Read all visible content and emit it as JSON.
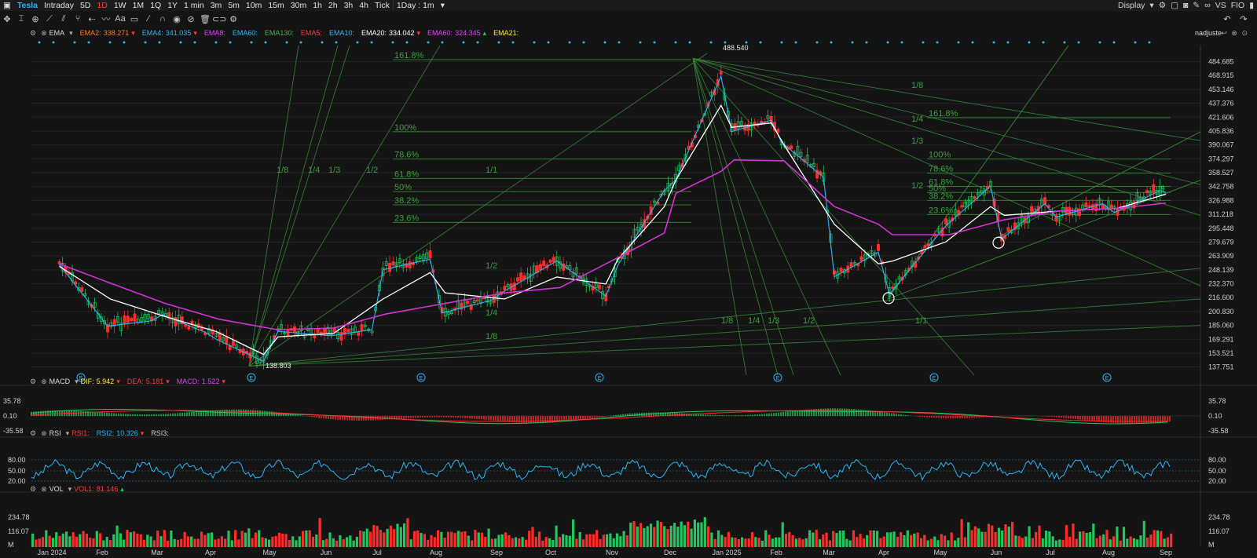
{
  "topbar": {
    "ticker": "Tesla",
    "periods": [
      "Intraday",
      "5D",
      "1D",
      "1W",
      "1M",
      "1Q",
      "1Y",
      "1 min",
      "3m",
      "5m",
      "10m",
      "15m",
      "30m",
      "1h",
      "2h",
      "3h",
      "4h",
      "Tick"
    ],
    "active_period": "1D",
    "interval_select": "1Day : 1m",
    "display_label": "Display",
    "vs_label": "VS",
    "fi_label": "FIO"
  },
  "main_legend": {
    "name": "EMA",
    "items": [
      {
        "label": "EMA2:",
        "value": "338.271",
        "color": "#ff7a29",
        "arrow": "down"
      },
      {
        "label": "EMA4:",
        "value": "341.035",
        "color": "#29b6f6",
        "arrow": "down"
      },
      {
        "label": "EMA8:",
        "value": "",
        "color": "#e040fb",
        "arrow": ""
      },
      {
        "label": "EMA60:",
        "value": "",
        "color": "#29b6f6",
        "arrow": ""
      },
      {
        "label": "EMA130:",
        "value": "",
        "color": "#4caf50",
        "arrow": ""
      },
      {
        "label": "EMA5:",
        "value": "",
        "color": "#ff3b3b",
        "arrow": ""
      },
      {
        "label": "EMA10:",
        "value": "",
        "color": "#29b6f6",
        "arrow": ""
      },
      {
        "label": "EMA20:",
        "value": "334.042",
        "color": "#ffffff",
        "arrow": "down"
      },
      {
        "label": "EMA60:",
        "value": "324.345",
        "color": "#e040fb",
        "arrow": "up"
      },
      {
        "label": "EMA21:",
        "value": "",
        "color": "#ffeb3b",
        "arrow": ""
      }
    ],
    "adjust_label": "nadjuste"
  },
  "chart_data": {
    "type": "candlestick",
    "title": "Tesla",
    "x_labels": [
      "Jan 2024",
      "Feb",
      "Mar",
      "Apr",
      "May",
      "Jun",
      "Jul",
      "Aug",
      "Sep",
      "Oct",
      "Nov",
      "Dec",
      "Jan 2025",
      "Feb",
      "Mar",
      "Apr",
      "May",
      "Jun",
      "Jul",
      "Aug",
      "Sep"
    ],
    "y_ticks": [
      "484.685",
      "468.915",
      "453.146",
      "437.376",
      "421.606",
      "405.836",
      "390.067",
      "374.297",
      "358.527",
      "342.758",
      "326.988",
      "311.218",
      "295.448",
      "279.679",
      "263.909",
      "248.139",
      "232.370",
      "216.600",
      "200.830",
      "185.060",
      "169.291",
      "153.521",
      "137.751"
    ],
    "ylim": [
      128.5,
      494.1
    ],
    "high_annotation": "488.540",
    "low_annotation": "138.803",
    "close_path": [
      [
        "Jan 2024",
        256
      ],
      [
        "Feb",
        186
      ],
      [
        "Feb",
        192
      ],
      [
        "Mar",
        199
      ],
      [
        "Mar",
        179
      ],
      [
        "Apr",
        171
      ],
      [
        "Apr",
        146
      ],
      [
        "May",
        180
      ],
      [
        "Jun",
        175
      ],
      [
        "Jun",
        182
      ],
      [
        "Jul",
        250
      ],
      [
        "Jul",
        262
      ],
      [
        "Aug",
        201
      ],
      [
        "Aug",
        215
      ],
      [
        "Sep",
        226
      ],
      [
        "Oct",
        260
      ],
      [
        "Oct",
        220
      ],
      [
        "Nov",
        255
      ],
      [
        "Nov",
        340
      ],
      [
        "Dec",
        352
      ],
      [
        "Dec",
        470
      ],
      [
        "Jan 2025",
        407
      ],
      [
        "Jan 2025",
        420
      ],
      [
        "Feb",
        395
      ],
      [
        "Feb",
        355
      ],
      [
        "Mar",
        242
      ],
      [
        "Mar",
        270
      ],
      [
        "Apr",
        222
      ],
      [
        "Apr",
        285
      ],
      [
        "May",
        300
      ],
      [
        "May",
        345
      ],
      [
        "Jun",
        285
      ],
      [
        "Jun",
        325
      ],
      [
        "Jul",
        310
      ],
      [
        "Jul",
        325
      ],
      [
        "Aug",
        315
      ],
      [
        "Aug",
        340
      ],
      [
        "Sep",
        338
      ]
    ],
    "ema20_path": [
      [
        "Jan 2024",
        252
      ],
      [
        "Feb",
        215
      ],
      [
        "Mar",
        195
      ],
      [
        "Apr",
        178
      ],
      [
        "Apr",
        152
      ],
      [
        "May",
        172
      ],
      [
        "Jun",
        176
      ],
      [
        "Jul",
        215
      ],
      [
        "Jul",
        245
      ],
      [
        "Aug",
        222
      ],
      [
        "Sep",
        215
      ],
      [
        "Oct",
        240
      ],
      [
        "Oct",
        232
      ],
      [
        "Nov",
        260
      ],
      [
        "Nov",
        320
      ],
      [
        "Dec",
        350
      ],
      [
        "Dec",
        435
      ],
      [
        "Jan 2025",
        410
      ],
      [
        "Jan 2025",
        415
      ],
      [
        "Feb",
        390
      ],
      [
        "Mar",
        300
      ],
      [
        "Mar",
        255
      ],
      [
        "Apr",
        258
      ],
      [
        "May",
        280
      ],
      [
        "May",
        320
      ],
      [
        "Jun",
        310
      ],
      [
        "Jul",
        315
      ],
      [
        "Aug",
        318
      ],
      [
        "Sep",
        334
      ]
    ],
    "ema60_path": [
      [
        "Jan 2024",
        255
      ],
      [
        "Feb",
        233
      ],
      [
        "Mar",
        210
      ],
      [
        "Apr",
        192
      ],
      [
        "May",
        180
      ],
      [
        "Jun",
        182
      ],
      [
        "Jul",
        198
      ],
      [
        "Aug",
        210
      ],
      [
        "Sep",
        222
      ],
      [
        "Oct",
        228
      ],
      [
        "Nov",
        262
      ],
      [
        "Nov",
        290
      ],
      [
        "Dec",
        335
      ],
      [
        "Dec",
        360
      ],
      [
        "Jan 2025",
        373
      ],
      [
        "Feb",
        372
      ],
      [
        "Mar",
        320
      ],
      [
        "Mar",
        300
      ],
      [
        "Apr",
        288
      ],
      [
        "May",
        288
      ],
      [
        "Jun",
        305
      ],
      [
        "Jul",
        315
      ],
      [
        "Aug",
        318
      ],
      [
        "Sep",
        324
      ]
    ],
    "fib_left": {
      "levels": [
        "161.8%",
        "100%",
        "78.6%",
        "61.8%",
        "50%",
        "38.2%",
        "23.6%"
      ],
      "values": [
        487,
        405,
        374,
        352,
        337,
        322,
        302
      ]
    },
    "fib_right": {
      "levels": [
        "161.8%",
        "100%",
        "78.6%",
        "61.8%",
        "50%",
        "38.2%",
        "23.6%"
      ],
      "values": [
        421,
        374,
        358,
        343,
        336,
        327,
        311
      ]
    },
    "fan_labels_left": [
      "1/8",
      "1/4",
      "1/3",
      "1/2",
      "1/1",
      "1/2",
      "1/4",
      "1/8"
    ],
    "fan_labels_right": [
      "1/8",
      "1/4",
      "1/3",
      "1/2",
      "1/1",
      "1/8",
      "1/4",
      "1/3",
      "1/2",
      "1/1"
    ],
    "event_marker": "E",
    "event_months": [
      "Jan 2024",
      "Apr",
      "Jul",
      "Oct",
      "Jan 2025",
      "Apr",
      "Jul"
    ]
  },
  "macd": {
    "name": "MACD",
    "dif_label": "DIF:",
    "dif_value": "5.942",
    "dea_label": "DEA:",
    "dea_value": "5.181",
    "macd_label": "MACD:",
    "macd_value": "1.522",
    "y_ticks": [
      "35.78",
      "0.10",
      "-35.58"
    ]
  },
  "rsi": {
    "name": "RSI",
    "rsi1_label": "RSI1:",
    "rsi2_label": "RSI2:",
    "rsi2_value": "10.326",
    "rsi3_label": "RSI3:",
    "y_ticks": [
      "80.00",
      "50.00",
      "20.00"
    ]
  },
  "vol": {
    "name": "VOL",
    "vol1_label": "VOL1:",
    "vol1_value": "81.146",
    "y_ticks": [
      "234.78",
      "116.07",
      "M"
    ]
  },
  "colors": {
    "up": "#ff2a2a",
    "down": "#22c55e",
    "ema20": "#ffffff",
    "ema60": "#d633d6",
    "ema_fast": "#29b6f6",
    "fib": "#2e7d32",
    "fan": "#3a8a3a"
  }
}
